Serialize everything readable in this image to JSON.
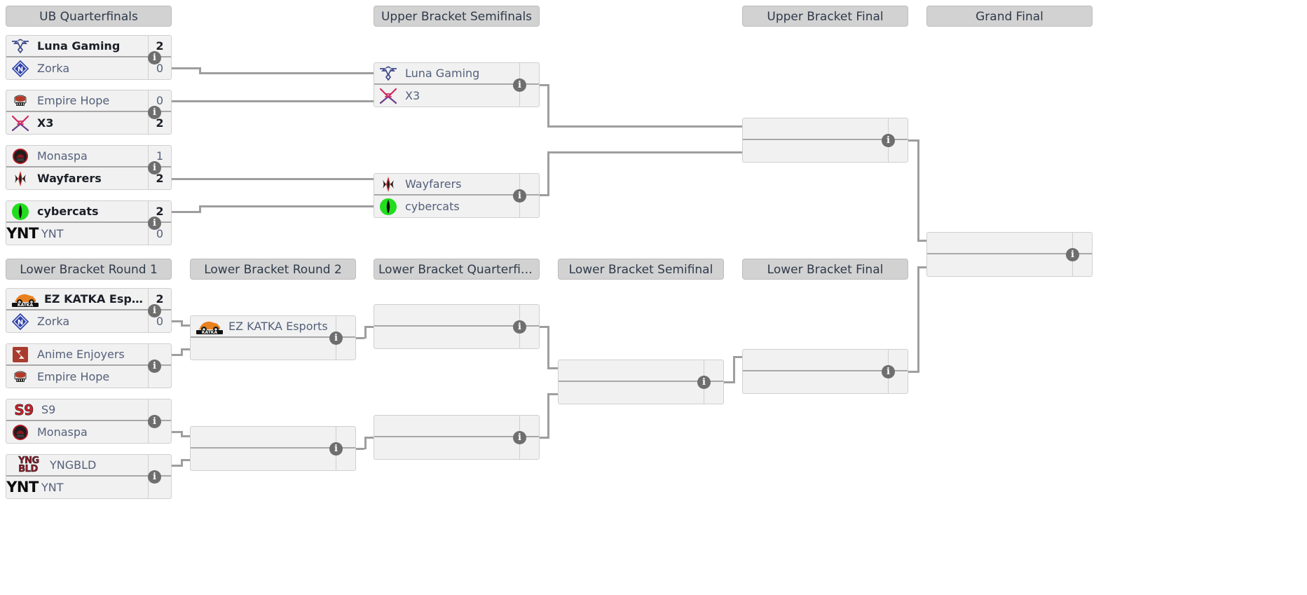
{
  "headers": [
    {
      "id": "ub-quarterfinals",
      "label": "UB Quarterfinals"
    },
    {
      "id": "upper-bracket-semifinals",
      "label": "Upper Bracket Semifinals"
    },
    {
      "id": "upper-bracket-final",
      "label": "Upper Bracket Final"
    },
    {
      "id": "grand-final",
      "label": "Grand Final"
    },
    {
      "id": "lower-bracket-round-1",
      "label": "Lower Bracket Round 1"
    },
    {
      "id": "lower-bracket-round-2",
      "label": "Lower Bracket Round 2"
    },
    {
      "id": "lower-bracket-quarterfinals",
      "label": "Lower Bracket Quarterfin..."
    },
    {
      "id": "lower-bracket-semifinal",
      "label": "Lower Bracket Semifinal"
    },
    {
      "id": "lower-bracket-final",
      "label": "Lower Bracket Final"
    }
  ],
  "info_label": "i",
  "matches": {
    "ubqf1": {
      "top": {
        "name": "Luna Gaming",
        "score": "2",
        "logo": "luna",
        "winner": true
      },
      "bottom": {
        "name": "Zorka",
        "score": "0",
        "logo": "zorka",
        "winner": false
      }
    },
    "ubqf2": {
      "top": {
        "name": "Empire Hope",
        "score": "0",
        "logo": "empire",
        "winner": false
      },
      "bottom": {
        "name": "X3",
        "score": "2",
        "logo": "x3",
        "winner": true
      }
    },
    "ubqf3": {
      "top": {
        "name": "Monaspa",
        "score": "1",
        "logo": "monaspa",
        "winner": false
      },
      "bottom": {
        "name": "Wayfarers",
        "score": "2",
        "logo": "wayfarers",
        "winner": true
      }
    },
    "ubqf4": {
      "top": {
        "name": "cybercats",
        "score": "2",
        "logo": "cybercats",
        "winner": true
      },
      "bottom": {
        "name": "YNT",
        "score": "0",
        "logo": "ynt",
        "winner": false
      }
    },
    "ubsf1": {
      "top": {
        "name": "Luna Gaming",
        "score": "",
        "logo": "luna",
        "winner": false
      },
      "bottom": {
        "name": "X3",
        "score": "",
        "logo": "x3",
        "winner": false
      }
    },
    "ubsf2": {
      "top": {
        "name": "Wayfarers",
        "score": "",
        "logo": "wayfarers",
        "winner": false
      },
      "bottom": {
        "name": "cybercats",
        "score": "",
        "logo": "cybercats",
        "winner": false
      }
    },
    "ubf": {
      "top": {
        "name": "",
        "score": "",
        "logo": "",
        "winner": false
      },
      "bottom": {
        "name": "",
        "score": "",
        "logo": "",
        "winner": false
      }
    },
    "gf": {
      "top": {
        "name": "",
        "score": "",
        "logo": "",
        "winner": false
      },
      "bottom": {
        "name": "",
        "score": "",
        "logo": "",
        "winner": false
      }
    },
    "lbr1m1": {
      "top": {
        "name": "EZ KATKA Esports",
        "score": "2",
        "logo": "ezkatka",
        "winner": true
      },
      "bottom": {
        "name": "Zorka",
        "score": "0",
        "logo": "zorka",
        "winner": false
      }
    },
    "lbr1m2": {
      "top": {
        "name": "Anime Enjoyers",
        "score": "",
        "logo": "anime",
        "winner": false
      },
      "bottom": {
        "name": "Empire Hope",
        "score": "",
        "logo": "empire",
        "winner": false
      }
    },
    "lbr1m3": {
      "top": {
        "name": "S9",
        "score": "",
        "logo": "s9",
        "winner": false
      },
      "bottom": {
        "name": "Monaspa",
        "score": "",
        "logo": "monaspa",
        "winner": false
      }
    },
    "lbr1m4": {
      "top": {
        "name": "YNGBLD",
        "score": "",
        "logo": "yngbld",
        "winner": false
      },
      "bottom": {
        "name": "YNT",
        "score": "",
        "logo": "ynt",
        "winner": false
      }
    },
    "lbr2m1": {
      "top": {
        "name": "EZ KATKA Esports",
        "score": "",
        "logo": "ezkatka",
        "winner": false
      },
      "bottom": {
        "name": "",
        "score": "",
        "logo": "",
        "winner": false
      }
    },
    "lbr2m2": {
      "top": {
        "name": "",
        "score": "",
        "logo": "",
        "winner": false
      },
      "bottom": {
        "name": "",
        "score": "",
        "logo": "",
        "winner": false
      }
    },
    "lbqf1": {
      "top": {
        "name": "",
        "score": "",
        "logo": "",
        "winner": false
      },
      "bottom": {
        "name": "",
        "score": "",
        "logo": "",
        "winner": false
      }
    },
    "lbqf2": {
      "top": {
        "name": "",
        "score": "",
        "logo": "",
        "winner": false
      },
      "bottom": {
        "name": "",
        "score": "",
        "logo": "",
        "winner": false
      }
    },
    "lbsf": {
      "top": {
        "name": "",
        "score": "",
        "logo": "",
        "winner": false
      },
      "bottom": {
        "name": "",
        "score": "",
        "logo": "",
        "winner": false
      }
    },
    "lbf": {
      "top": {
        "name": "",
        "score": "",
        "logo": "",
        "winner": false
      },
      "bottom": {
        "name": "",
        "score": "",
        "logo": "",
        "winner": false
      }
    }
  },
  "colors": {
    "header_bg": "#d2d2d2",
    "match_bg": "#f1f1f1",
    "match_border": "#cfcfcf",
    "row_divider": "#a8a8a8",
    "connector": "#9e9e9e",
    "winner_text": "#1b1f28",
    "loser_text": "#54607a",
    "info_badge": "#6e6e6e",
    "cybercats_green": "#22dd1e",
    "x3_pink": "#d12a63",
    "luna_navy": "#3f4a8a",
    "s9_red": "#cc2029",
    "yngbld_maroon": "#8c1f2a",
    "ezkatka_orange": "#e8811e",
    "anime_red": "#a93b2e"
  }
}
